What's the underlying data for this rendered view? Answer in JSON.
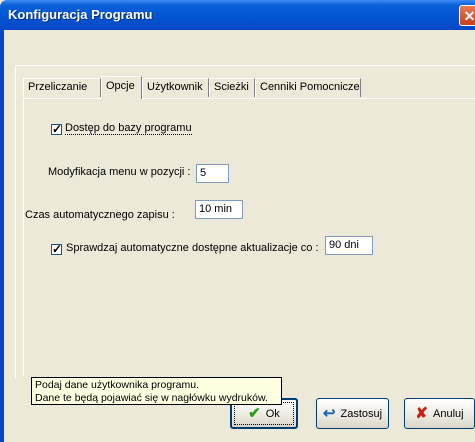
{
  "window": {
    "title": "Konfiguracja Programu"
  },
  "tabs": [
    {
      "label": "Przeliczanie"
    },
    {
      "label": "Opcje"
    },
    {
      "label": "Użytkownik"
    },
    {
      "label": "Scieżki"
    },
    {
      "label": "Cenniki Pomocnicze"
    }
  ],
  "active_tab": "Opcje",
  "options": {
    "db_access": {
      "label": "Dostęp do bazy programu",
      "checked": true
    },
    "menu_position": {
      "label": "Modyfikacja menu w pozycji :",
      "value": "5"
    },
    "autosave": {
      "label": "Czas automatycznego zapisu :",
      "value": "10 min"
    },
    "auto_update": {
      "label": "Sprawdzaj automatyczne dostępne aktualizacje co :",
      "checked": true,
      "value": "90 dni"
    }
  },
  "tooltip": {
    "line1": "Podaj dane użytkownika programu.",
    "line2": "Dane te będą pojawiać się w nagłówku wydruków."
  },
  "buttons": {
    "ok": {
      "label": "Ok"
    },
    "apply": {
      "label": "Zastosuj"
    },
    "cancel": {
      "label": "Anuluj"
    }
  },
  "colors": {
    "titlebar": "#0355d3",
    "ok_icon": "#2d9b1e",
    "cancel_icon": "#c81d11",
    "tooltip_bg": "#ffffe1"
  },
  "icons": {
    "ok": "check-icon",
    "apply": "apply-arrow-icon",
    "cancel": "x-icon",
    "close": "close-icon"
  }
}
